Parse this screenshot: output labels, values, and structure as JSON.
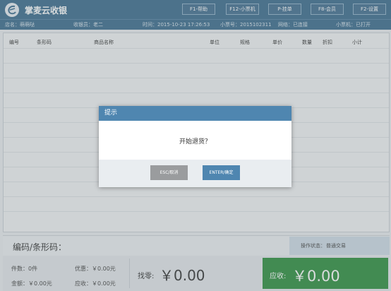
{
  "app": {
    "title": "掌麦云收银"
  },
  "fkeys": [
    {
      "label": "F1-帮助"
    },
    {
      "label": "F12-小票机"
    },
    {
      "label": "P-挂单"
    },
    {
      "label": "F8-会员"
    },
    {
      "label": "F2-设置"
    }
  ],
  "info": {
    "store": "店名：萌萌哒",
    "cashier": "收银员：老二",
    "time": "时间：2015-10-23 17:26:53",
    "ticket_no": "小票号：2015102311",
    "network": "网络：已连接",
    "printer": "小票机：已打开"
  },
  "table": {
    "columns": [
      "编号",
      "条形码",
      "商品名称",
      "单位",
      "规格",
      "单价",
      "数量",
      "折扣",
      "小计"
    ]
  },
  "scan": {
    "label": "编码/条形码："
  },
  "status": {
    "label": "操作状态：",
    "value": "普通交易"
  },
  "summary": {
    "items": "件数：0件",
    "amount": "金额：￥0.00元",
    "discount": "优惠：￥0.00元",
    "receivable": "应收：￥0.00元",
    "change_label": "找零:",
    "change_amount": "￥0.00",
    "due_label": "应收:",
    "due_amount": "￥0.00"
  },
  "dialog": {
    "title": "提示",
    "message": "开始退货？",
    "cancel_label": "ESC/取消",
    "ok_label": "ENTER/确定"
  },
  "colors": {
    "header": "#3c6d8e",
    "dialog_header": "#4f86b0",
    "due_box": "#2f8f3f"
  }
}
